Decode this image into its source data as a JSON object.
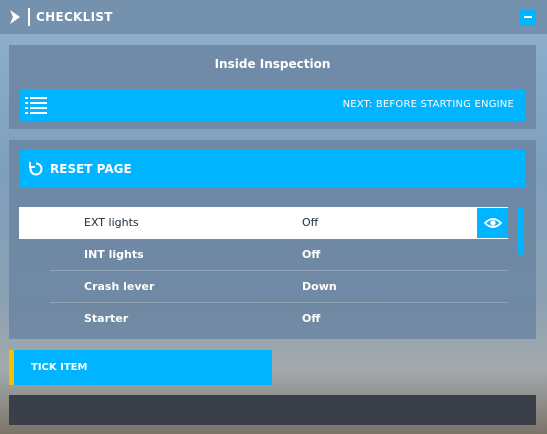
{
  "window": {
    "title": "CHECKLIST"
  },
  "section": {
    "title": "Inside Inspection",
    "next_label": "NEXT: BEFORE STARTING ENGINE"
  },
  "checklist": {
    "reset_label": "RESET PAGE",
    "rows": [
      {
        "item": "EXT lights",
        "value": "Off"
      },
      {
        "item": "INT lights",
        "value": "Off"
      },
      {
        "item": "Crash lever",
        "value": "Down"
      },
      {
        "item": "Starter",
        "value": "Off"
      }
    ]
  },
  "actions": {
    "tick_label": "TICK ITEM"
  },
  "colors": {
    "accent": "#00b4ff",
    "highlight": "#f5c000"
  },
  "icons": {
    "title": "chevron-right-icon",
    "minimize": "minimize-icon",
    "list": "list-icon",
    "reset": "reset-icon",
    "eye": "eye-icon"
  }
}
